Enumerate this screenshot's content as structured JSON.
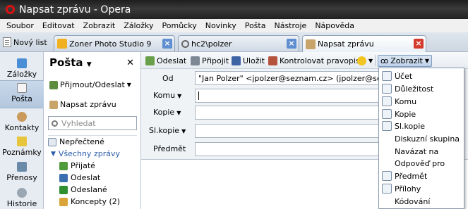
{
  "window": {
    "title": "Napsat zprávu - Opera"
  },
  "menubar": [
    "Soubor",
    "Editovat",
    "Zobrazit",
    "Záložky",
    "Pomůcky",
    "Novinky",
    "Pošta",
    "Nástroje",
    "Nápověda"
  ],
  "tabs": {
    "new_list": "Nový list",
    "items": [
      {
        "label": "Zoner Photo Studio 9",
        "icon": "zoner-star-icon"
      },
      {
        "label": "hc2\\polzer",
        "icon": "search-icon"
      },
      {
        "label": "Napsat zprávu",
        "icon": "compose-mail-icon"
      }
    ]
  },
  "leftbar": [
    "Záložky",
    "Pošta",
    "Kontakty",
    "Poznámky",
    "Přenosy",
    "Historie"
  ],
  "mail_panel": {
    "title": "Pošta",
    "receive_send": "Přijmout/Odeslat",
    "compose": "Napsat zprávu",
    "search_placeholder": "Vyhledat",
    "folders": {
      "unread": "Nepřečtené",
      "all_mail": "Všechny zprávy",
      "received": "Přijaté",
      "outbox": "Odeslat",
      "sent": "Odeslané",
      "drafts": "Koncepty (2)"
    }
  },
  "toolbar": {
    "send": "Odeslat",
    "attach": "Připojit",
    "save": "Uložit",
    "spellcheck": "Kontrolovat pravopis",
    "view": "Zobrazit"
  },
  "compose": {
    "from_label": "Od",
    "from_value": "\"Jan Polzer\" <jpolzer@seznam.cz>   (jpolzer@seznam",
    "to_label": "Komu",
    "cc_label": "Kopie",
    "bcc_label": "Sl.kopie",
    "subject_label": "Předmět"
  },
  "view_menu": [
    {
      "label": "Účet",
      "checked": true
    },
    {
      "label": "Důležitost",
      "checked": true
    },
    {
      "label": "Komu",
      "checked": true
    },
    {
      "label": "Kopie",
      "checked": true
    },
    {
      "label": "Sl.kopie",
      "checked": true
    },
    {
      "label": "Diskuzní skupina",
      "checked": false
    },
    {
      "label": "Navázat na",
      "checked": false
    },
    {
      "label": "Odpověď pro",
      "checked": false
    },
    {
      "label": "Předmět",
      "checked": true
    },
    {
      "label": "Přílohy",
      "checked": true
    },
    {
      "label": "Kódování",
      "checked": false
    }
  ],
  "colors": {
    "accent": "#d43b2f",
    "tab_close": "#5f8ed1",
    "folder_link": "#2a5caa"
  }
}
